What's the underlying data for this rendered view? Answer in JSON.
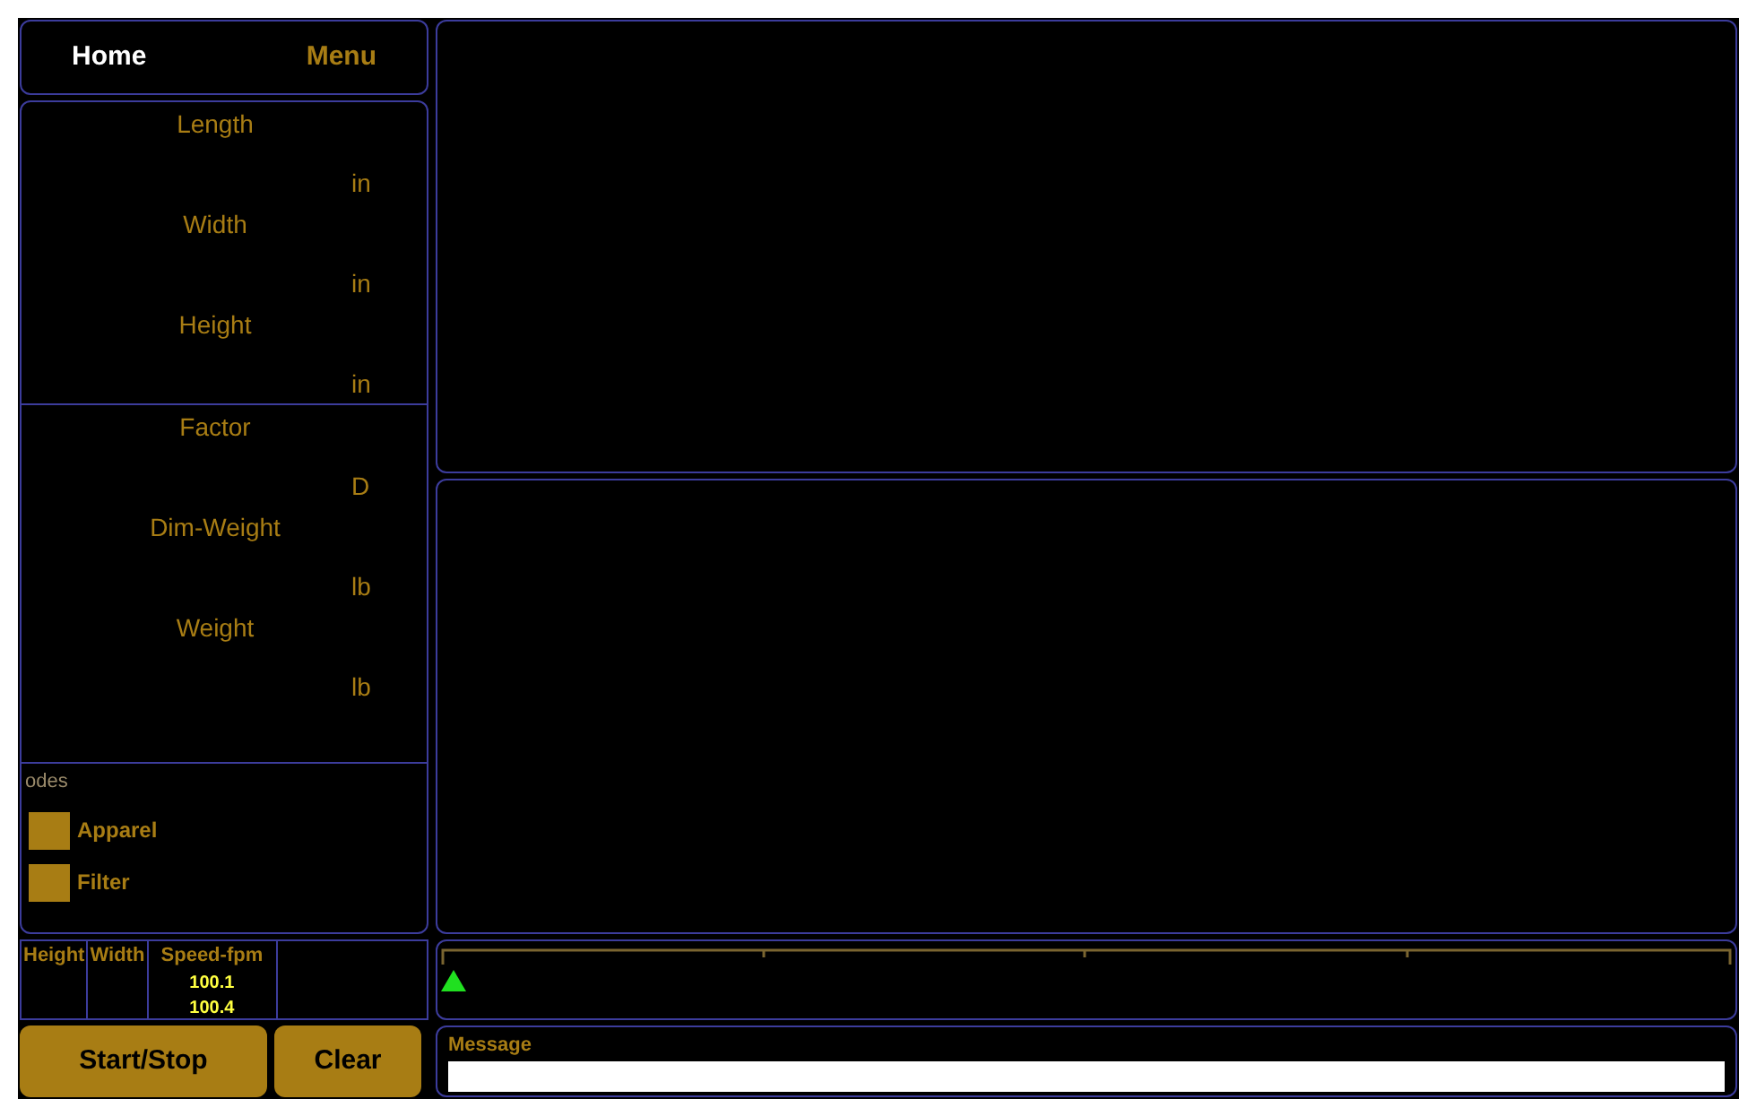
{
  "header": {
    "home": "Home",
    "menu": "Menu"
  },
  "field_groups": [
    [
      {
        "label": "Length",
        "unit": "in"
      },
      {
        "label": "Width",
        "unit": "in"
      },
      {
        "label": "Height",
        "unit": "in"
      }
    ],
    [
      {
        "label": "Factor",
        "unit": "D"
      },
      {
        "label": "Dim-Weight",
        "unit": "lb"
      },
      {
        "label": "Weight",
        "unit": "lb"
      }
    ]
  ],
  "modes": {
    "title": "odes",
    "items": [
      {
        "label": "Apparel",
        "checked": false
      },
      {
        "label": "Filter",
        "checked": false
      }
    ]
  },
  "readings": {
    "columns": [
      "Height",
      "Width",
      "Speed-fpm"
    ],
    "speed_values": [
      "100.1",
      "100.4"
    ]
  },
  "buttons": [
    "Start/Stop",
    "Clear"
  ],
  "message": {
    "label": "Message"
  }
}
